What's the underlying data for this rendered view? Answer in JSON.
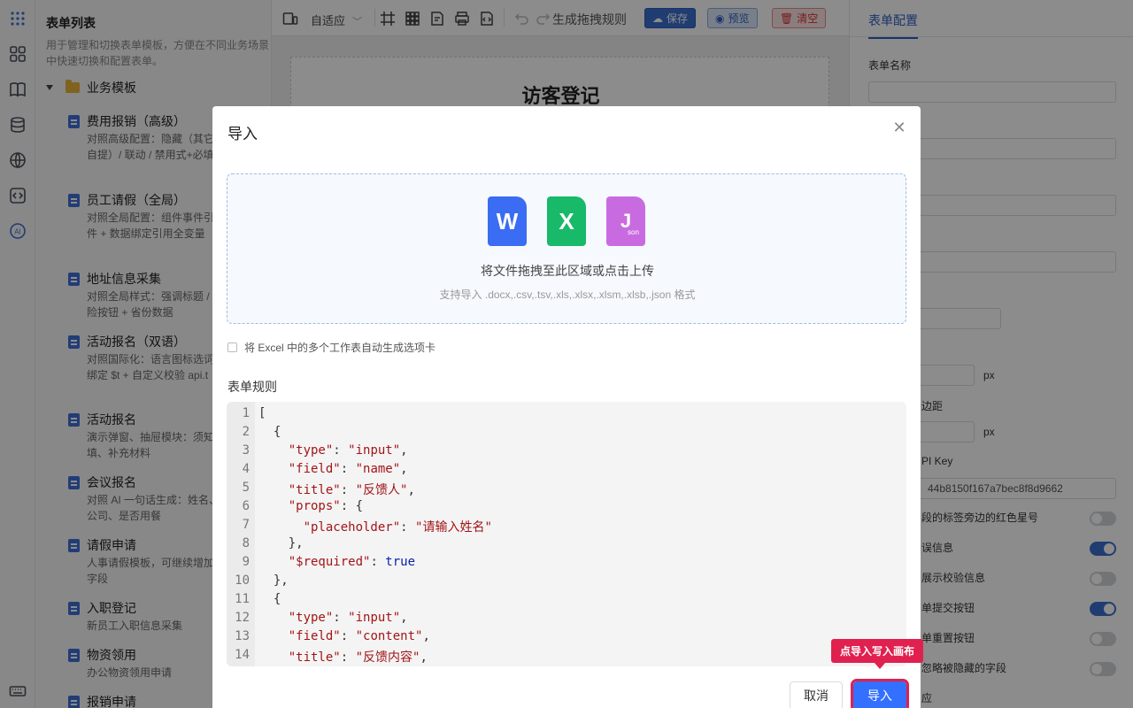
{
  "rail": {
    "icons": [
      "grid-dots-icon",
      "apps-icon",
      "book-icon",
      "database-icon",
      "globe-icon",
      "code-icon",
      "ai-icon",
      "keyboard-icon"
    ]
  },
  "template_list": {
    "title": "表单列表",
    "description": "用于管理和切换表单模板，方便在不同业务场景中快速切换和配置表单。",
    "group": "业务模板",
    "items": [
      {
        "name": "费用报销（高级）",
        "sub": "对照高级配置：隐藏（其它明/快递自提）/ 联动 / 禁用式+必填"
      },
      {
        "name": "员工请假（全局）",
        "sub": "对照全局配置：组件事件引全局事件 + 数据绑定引用全变量"
      },
      {
        "name": "地址信息采集",
        "sub": "对照全局样式：强调标题 / 按钮 / 危险按钮 + 省份数据"
      },
      {
        "name": "活动报名（双语）",
        "sub": "对照国际化：语言图标选词 + 数据绑定 $t + 自定义校验 api.t"
      },
      {
        "name": "活动报名",
        "sub": "演示弹窗、抽屉模块：须知选品回填、补充材料"
      },
      {
        "name": "会议报名",
        "sub": "对照 AI 一句话生成：姓名、机号、公司、是否用餐"
      },
      {
        "name": "请假申请",
        "sub": "人事请假模板，可继续增加理人等字段"
      },
      {
        "name": "入职登记",
        "sub": "新员工入职信息采集"
      },
      {
        "name": "物资领用",
        "sub": "办公物资领用申请"
      },
      {
        "name": "报销申请",
        "sub": ""
      }
    ]
  },
  "toolbar": {
    "mode": "自适应",
    "generate": "生成拖拽规则",
    "save": "保存",
    "preview": "预览",
    "clear": "清空"
  },
  "canvas": {
    "title": "访客登记"
  },
  "config": {
    "tab": "表单配置",
    "form_name_label": "表单名称",
    "px1": "px",
    "px2": "px",
    "margin_label": "边距",
    "api_key_label": "PI Key",
    "api_key_value": "44b8150f167a7bec8f8d9662",
    "opt1": "段的标签旁边的红色星号",
    "opt2": "误信息",
    "opt3": "展示校验信息",
    "opt4": "单提交按钮",
    "opt5": "单重置按钮",
    "opt6": "忽略被隐藏的字段",
    "opt7": "应"
  },
  "modal": {
    "title": "导入",
    "drop_main": "将文件拖拽至此区域或点击上传",
    "drop_sub": "支持导入 .docx,.csv,.tsv,.xls,.xlsx,.xlsm,.xlsb,.json 格式",
    "file_icons": {
      "word": "W",
      "excel": "X",
      "json": "J",
      "json_small": "son"
    },
    "checkbox_label": "将 Excel 中的多个工作表自动生成选项卡",
    "rules_title": "表单规则",
    "cancel": "取消",
    "import": "导入",
    "tooltip": "点导入写入画布"
  },
  "code_lines": [
    "[",
    "  {",
    "    \"type\": \"input\",",
    "    \"field\": \"name\",",
    "    \"title\": \"反馈人\",",
    "    \"props\": {",
    "      \"placeholder\": \"请输入姓名\"",
    "    },",
    "    \"$required\": true",
    "  },",
    "  {",
    "    \"type\": \"input\",",
    "    \"field\": \"content\",",
    "    \"title\": \"反馈内容\","
  ],
  "colors": {
    "accent": "#3370ff",
    "save": "#3b6fd0",
    "danger": "#e0204e",
    "word": "#3a6cf4",
    "excel": "#18b968",
    "json": "#c96be0"
  }
}
